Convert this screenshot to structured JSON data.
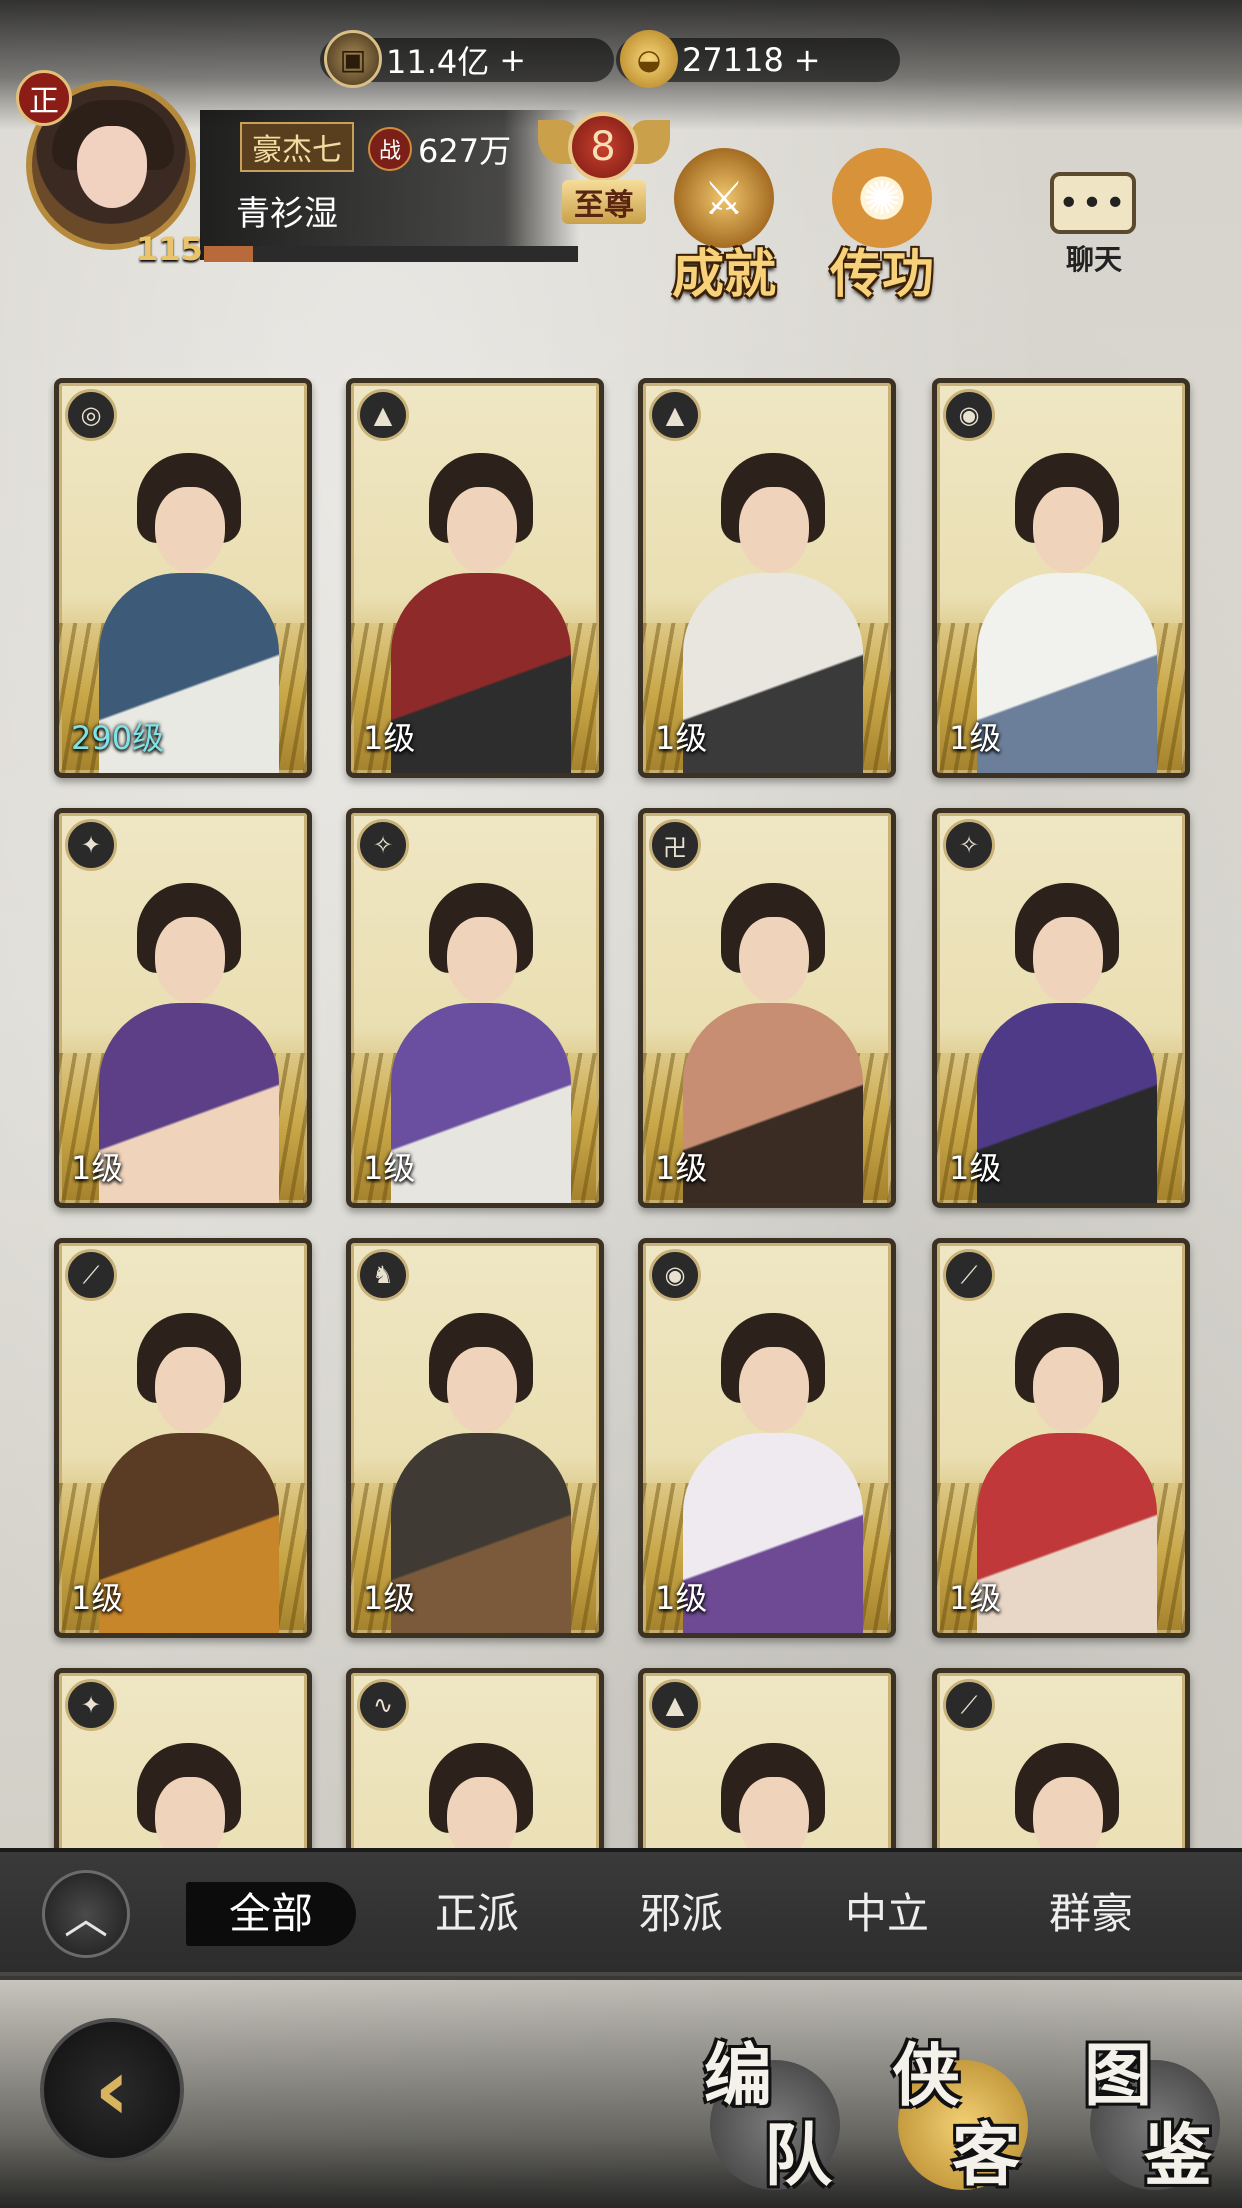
{
  "currency": {
    "coins": "11.4亿",
    "gold": "27118",
    "plus": "+"
  },
  "profile": {
    "rank": "正",
    "level": "115",
    "name": "豪杰七",
    "power_icon": "战",
    "power": "627万",
    "subtitle": "青衫湿",
    "exp_progress": 0.13
  },
  "vip": {
    "level": "8",
    "title": "至尊"
  },
  "features": {
    "achievement": "成就",
    "transmit": "传功",
    "chat_dots": "•••",
    "chat": "聊天"
  },
  "cards": [
    {
      "level": "290级",
      "faction_icon": "water-faction-icon",
      "faction_glyph": "◎",
      "colors": [
        "#3d5a78",
        "#e9e9e3"
      ]
    },
    {
      "level": "1级",
      "faction_icon": "tent-faction-icon",
      "faction_glyph": "▲",
      "colors": [
        "#8e2a2a",
        "#2d2d2d"
      ]
    },
    {
      "level": "1级",
      "faction_icon": "tent-faction-icon",
      "faction_glyph": "▲",
      "colors": [
        "#e8e6df",
        "#3a3a3a"
      ]
    },
    {
      "level": "1级",
      "faction_icon": "mask-faction-icon",
      "faction_glyph": "◉",
      "colors": [
        "#f1f1ee",
        "#6b7f9a"
      ]
    },
    {
      "level": "1级",
      "faction_icon": "beast-faction-icon",
      "faction_glyph": "✦",
      "colors": [
        "#5c3f86",
        "#efd3bb"
      ]
    },
    {
      "level": "1级",
      "faction_icon": "scorpion-faction-icon",
      "faction_glyph": "✧",
      "colors": [
        "#6a4fa0",
        "#e7e5e0"
      ]
    },
    {
      "level": "1级",
      "faction_icon": "swastika-faction-icon",
      "faction_glyph": "卍",
      "colors": [
        "#c78e73",
        "#3a2c22"
      ]
    },
    {
      "level": "1级",
      "faction_icon": "scorpion-faction-icon",
      "faction_glyph": "✧",
      "colors": [
        "#4e3a86",
        "#2a2a2a"
      ]
    },
    {
      "level": "1级",
      "faction_icon": "blade-faction-icon",
      "faction_glyph": "⟋",
      "colors": [
        "#5a3b23",
        "#c8862b"
      ]
    },
    {
      "level": "1级",
      "faction_icon": "horse-faction-icon",
      "faction_glyph": "♞",
      "colors": [
        "#3f3a33",
        "#7a5a3a"
      ]
    },
    {
      "level": "1级",
      "faction_icon": "mask-faction-icon",
      "faction_glyph": "◉",
      "colors": [
        "#eeeaf0",
        "#6d4a93"
      ]
    },
    {
      "level": "1级",
      "faction_icon": "blade-faction-icon",
      "faction_glyph": "⟋",
      "colors": [
        "#c0383a",
        "#e8d6c6"
      ]
    },
    {
      "level": "",
      "faction_icon": "beast-faction-icon",
      "faction_glyph": "✦",
      "colors": [
        "#6d5aa0",
        "#efd3bb"
      ]
    },
    {
      "level": "",
      "faction_icon": "snake-faction-icon",
      "faction_glyph": "∿",
      "colors": [
        "#efd3bb",
        "#2c221b"
      ]
    },
    {
      "level": "",
      "faction_icon": "tent-faction-icon",
      "faction_glyph": "▲",
      "colors": [
        "#efd3bb",
        "#3a2c22"
      ]
    },
    {
      "level": "",
      "faction_icon": "blade-faction-icon",
      "faction_glyph": "⟋",
      "colors": [
        "#a2292a",
        "#2b2b2b"
      ]
    }
  ],
  "filters": {
    "collapse": "︿",
    "tabs": [
      "全部",
      "正派",
      "邪派",
      "中立",
      "群豪"
    ]
  },
  "bottom_nav": {
    "back": "‹",
    "formation": [
      "编",
      "队"
    ],
    "heroes": [
      "侠",
      "客"
    ],
    "codex": [
      "图",
      "鉴"
    ]
  }
}
